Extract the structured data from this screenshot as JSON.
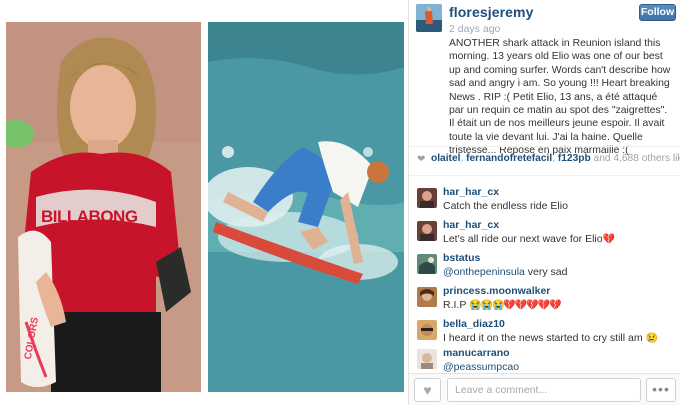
{
  "post": {
    "username": "floresjeremy",
    "follow_label": "Follow",
    "timestamp": "2 days ago",
    "caption": "ANOTHER shark attack in Reunion island this morning. 13 years old Elio was one of our best up and coming surfer. Words can't describe how sad and angry i am. So young !!! Heart breaking News . RIP :( Petit Elio, 13 ans, a été attaqué par un requin ce matin au spot des \"zaigrettes\". Il était un de nos meilleurs jeune espoir. Il avait toute la vie devant lui. J'ai la haine. Quelle tristesse... Repose en paix marmaille :("
  },
  "photos": {
    "left_alt_text": "BILLABONG",
    "board_text": "COLORS"
  },
  "likes": {
    "user1": "olaitel",
    "user2": "fernandofretefacil",
    "user3": "f123pb",
    "suffix_and": "and",
    "count": "4,688",
    "suffix_others": "others like this."
  },
  "comments": [
    {
      "user": "har_har_cx",
      "text": "Catch the endless ride Elio",
      "emoji": ""
    },
    {
      "user": "har_har_cx",
      "text": "Let's all ride our next wave for Elio",
      "emoji": "💔"
    },
    {
      "user": "bstatus",
      "mention": "@onthepeninsula",
      "text": " very sad",
      "emoji": ""
    },
    {
      "user": "princess.moonwalker",
      "text": "R.I.P ",
      "emoji": "😭😭😭💔💔💔💔💔"
    },
    {
      "user": "bella_diaz10",
      "text": "I heard it on the news started to cry still am ",
      "emoji": "😢"
    },
    {
      "user": "manucarrano",
      "mention": "@peassumpcao",
      "text": "",
      "emoji": ""
    }
  ],
  "footer": {
    "comment_placeholder": "Leave a comment...",
    "like_icon": "heart-icon",
    "more_icon": "ellipsis-icon",
    "more_label": "•••",
    "like_label": "♥"
  },
  "colors": {
    "username": "#1d4f7a",
    "follow_button": "#4a80b3",
    "timestamp": "#9aa8b6"
  }
}
